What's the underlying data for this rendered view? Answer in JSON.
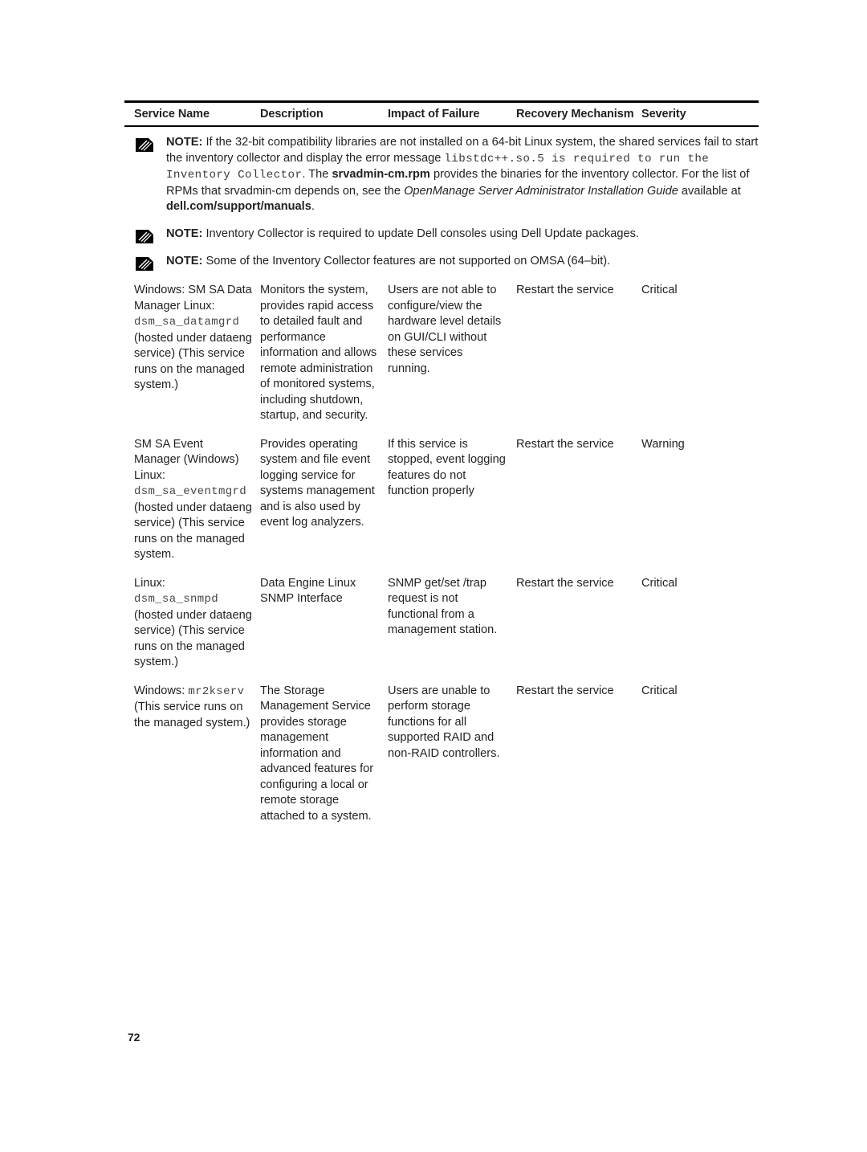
{
  "document": {
    "page_number": "72"
  },
  "table": {
    "headers": [
      "Service Name",
      "Description",
      "Impact of Failure",
      "Recovery Mechanism",
      "Severity"
    ],
    "rows": [
      {
        "service_name_pre": "Windows: SM SA Data Manager Linux: ",
        "service_name_mono": "dsm_sa_datamgrd",
        "service_name_post": " (hosted under dataeng service) (This service runs on the managed system.)",
        "description": "Monitors the system, provides rapid access to detailed fault and performance information and allows remote administration of monitored systems, including shutdown, startup, and security.",
        "impact": "Users are not able to configure/view the hardware level details on GUI/CLI without these services running.",
        "recovery": "Restart the service",
        "severity": "Critical"
      },
      {
        "service_name_pre": "SM SA Event Manager (Windows) Linux: ",
        "service_name_mono": "dsm_sa_eventmgrd",
        "service_name_post": " (hosted under dataeng service) (This service runs on the managed system.",
        "description": "Provides operating system and file event logging service for systems management and is also used by event log analyzers.",
        "impact": "If this service is stopped, event logging features do not function properly",
        "recovery": "Restart the service",
        "severity": "Warning"
      },
      {
        "service_name_pre": "Linux: ",
        "service_name_mono": "dsm_sa_snmpd",
        "service_name_post": " (hosted under dataeng service) (This service runs on the managed system.)",
        "description": "Data Engine Linux SNMP Interface",
        "impact": "SNMP get/set /trap request is not functional from a management station.",
        "recovery": "Restart the service",
        "severity": "Critical"
      },
      {
        "service_name_pre": "Windows: ",
        "service_name_mono": "mr2kserv",
        "service_name_post": " (This service runs on the managed system.)",
        "description": "The Storage Management Service provides storage management information and advanced features for configuring a local or remote storage attached to a system.",
        "impact": "Users are unable to perform storage functions for all supported RAID and non-RAID controllers.",
        "recovery": "Restart the service",
        "severity": "Critical"
      }
    ]
  },
  "notes": [
    {
      "label": "NOTE:",
      "segments": [
        {
          "type": "text",
          "value": " If the 32-bit compatibility libraries are not installed on a 64-bit Linux system, the shared services fail to start the inventory collector and display the error message "
        },
        {
          "type": "mono",
          "value": "libstdc++.so.5 is required to run the Inventory Collector"
        },
        {
          "type": "text",
          "value": ". The "
        },
        {
          "type": "bold",
          "value": "srvadmin-cm.rpm"
        },
        {
          "type": "text",
          "value": " provides the binaries for the inventory collector. For the list of RPMs that srvadmin-cm depends on, see the "
        },
        {
          "type": "italic",
          "value": "OpenManage Server Administrator Installation Guide"
        },
        {
          "type": "text",
          "value": " available at "
        },
        {
          "type": "bold",
          "value": "dell.com/support/manuals"
        },
        {
          "type": "text",
          "value": "."
        }
      ]
    },
    {
      "label": "NOTE:",
      "segments": [
        {
          "type": "text",
          "value": " Inventory Collector is required to update Dell consoles using Dell Update packages."
        }
      ]
    },
    {
      "label": "NOTE:",
      "segments": [
        {
          "type": "text",
          "value": " Some of the Inventory Collector features are not supported on OMSA (64–bit)."
        }
      ]
    }
  ],
  "colors": {
    "text": "#231f20",
    "mono_text": "#454545",
    "rule": "#000000",
    "background": "#ffffff"
  }
}
